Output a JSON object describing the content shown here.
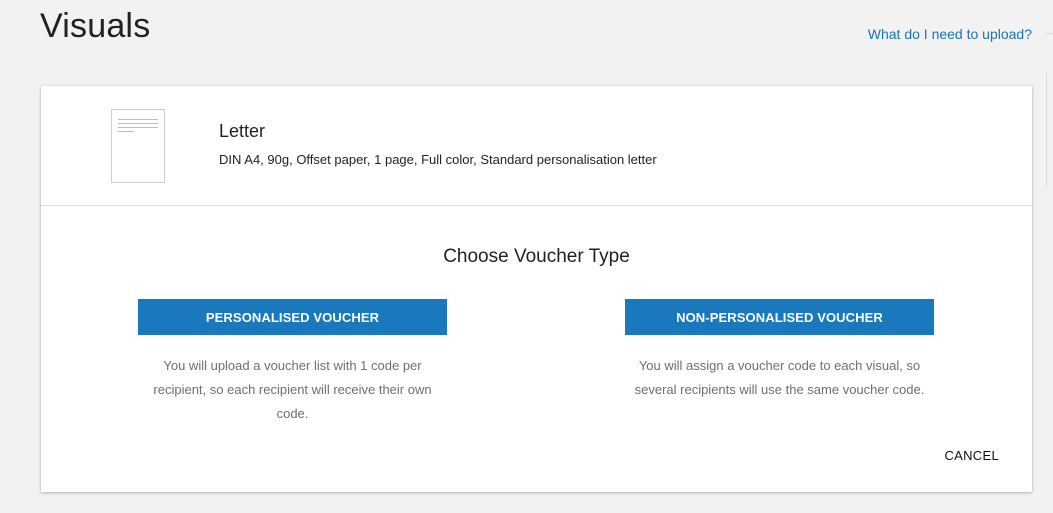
{
  "header": {
    "title": "Visuals",
    "help_link": "What do I need to upload?"
  },
  "product": {
    "thumbnail_icon": "letter-document-icon",
    "name": "Letter",
    "description": "DIN A4, 90g, Offset paper, 1 page, Full color, Standard personalisation letter"
  },
  "voucher_chooser": {
    "title": "Choose Voucher Type",
    "options": [
      {
        "button_label": "PERSONALISED VOUCHER",
        "description": "You will upload a voucher list with 1 code per recipient, so each recipient will receive their own code."
      },
      {
        "button_label": "NON-PERSONALISED VOUCHER",
        "description": "You will assign a voucher code to each visual, so several recipients will use the same voucher code."
      }
    ],
    "cancel_label": "CANCEL"
  },
  "colors": {
    "accent": "#1a78bd",
    "link": "#1a73b8",
    "background": "#f2f2f2",
    "card": "#ffffff"
  }
}
